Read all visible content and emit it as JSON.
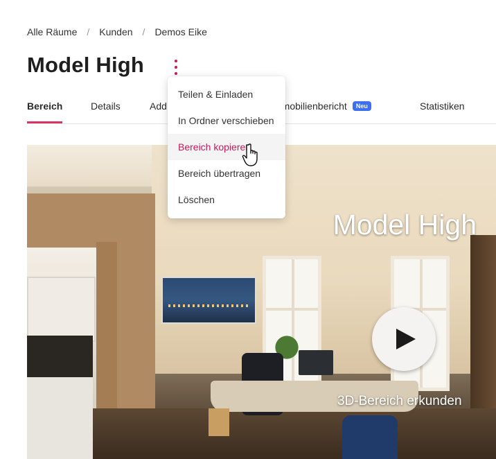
{
  "breadcrumb": {
    "items": [
      "Alle Räume",
      "Kunden",
      "Demos Eike"
    ],
    "separator": "/"
  },
  "page": {
    "title": "Model High",
    "menu_icon": "kebab-menu-icon"
  },
  "tabs": [
    {
      "label": "Bereich",
      "active": true
    },
    {
      "label": "Details",
      "active": false
    },
    {
      "label": "Add",
      "active": false
    },
    {
      "label": "mmobilienbericht",
      "active": false,
      "badge": "Neu"
    },
    {
      "label": "Statistiken",
      "active": false
    }
  ],
  "context_menu": {
    "items": [
      {
        "label": "Teilen & Einladen"
      },
      {
        "label": "In Ordner verschieben"
      },
      {
        "label": "Bereich kopieren",
        "hovered": true
      },
      {
        "label": "Bereich übertragen"
      },
      {
        "label": "Löschen"
      }
    ]
  },
  "hero": {
    "title": "Model High",
    "cta_label": "3D-Bereich erkunden",
    "play_icon": "play-icon"
  },
  "colors": {
    "accent": "#c8195a",
    "tab_underline": "#d6365f",
    "badge": "#3d6ff0"
  }
}
